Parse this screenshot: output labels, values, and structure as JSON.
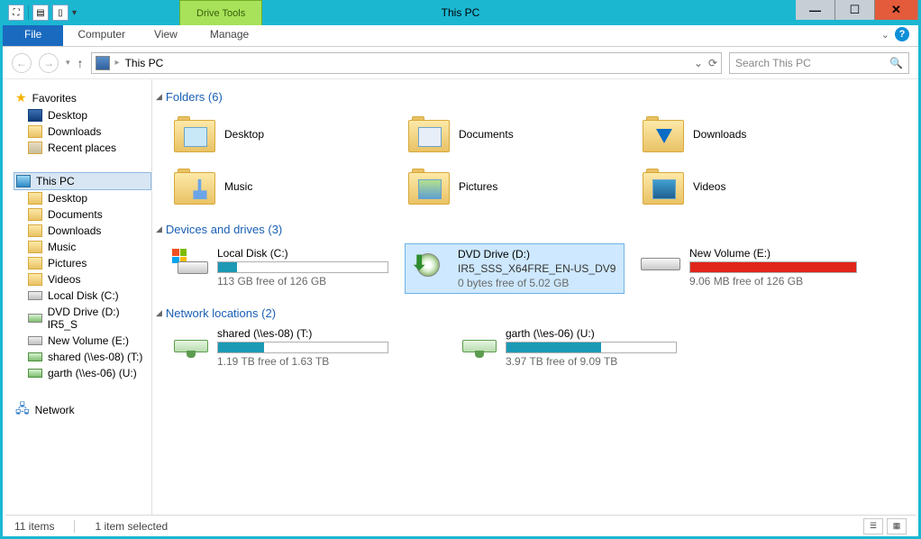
{
  "window": {
    "title": "This PC"
  },
  "ribbon": {
    "drive_tools": "Drive Tools",
    "file": "File",
    "computer": "Computer",
    "view": "View",
    "manage": "Manage"
  },
  "address": {
    "location": "This PC"
  },
  "search": {
    "placeholder": "Search This PC"
  },
  "sidebar": {
    "favorites": {
      "label": "Favorites",
      "items": [
        "Desktop",
        "Downloads",
        "Recent places"
      ]
    },
    "thispc": {
      "label": "This PC",
      "items": [
        "Desktop",
        "Documents",
        "Downloads",
        "Music",
        "Pictures",
        "Videos",
        "Local Disk (C:)",
        "DVD Drive (D:) IR5_S",
        "New Volume (E:)",
        "shared (\\\\es-08) (T:)",
        "garth (\\\\es-06) (U:)"
      ]
    },
    "network": {
      "label": "Network"
    }
  },
  "sections": {
    "folders": {
      "title": "Folders (6)",
      "items": [
        "Desktop",
        "Documents",
        "Downloads",
        "Music",
        "Pictures",
        "Videos"
      ]
    },
    "drives": {
      "title": "Devices and drives (3)",
      "items": [
        {
          "name": "Local Disk (C:)",
          "sub": "",
          "free": "113 GB free of 126 GB",
          "fill": 11,
          "color": "blue"
        },
        {
          "name": "DVD Drive (D:)",
          "sub": "IR5_SSS_X64FRE_EN-US_DV9",
          "free": "0 bytes free of 5.02 GB",
          "fill": 0,
          "color": "none",
          "selected": true
        },
        {
          "name": "New Volume (E:)",
          "sub": "",
          "free": "9.06 MB free of 126 GB",
          "fill": 100,
          "color": "red"
        }
      ]
    },
    "netloc": {
      "title": "Network locations (2)",
      "items": [
        {
          "name": "shared (\\\\es-08) (T:)",
          "free": "1.19 TB free of 1.63 TB",
          "fill": 27
        },
        {
          "name": "garth (\\\\es-06) (U:)",
          "free": "3.97 TB free of 9.09 TB",
          "fill": 56
        }
      ]
    }
  },
  "status": {
    "count": "11 items",
    "selected": "1 item selected"
  }
}
